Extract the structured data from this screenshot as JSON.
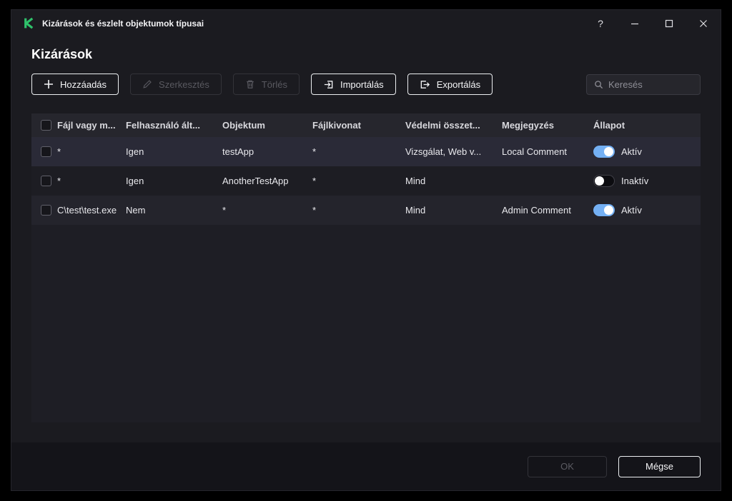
{
  "colors": {
    "brand_green": "#2fc26b",
    "toggle_active": "#74b0f4"
  },
  "window": {
    "title": "Kizárások és észlelt objektumok típusai",
    "controls": {
      "help": "?"
    }
  },
  "page": {
    "heading": "Kizárások"
  },
  "toolbar": {
    "add_label": "Hozzáadás",
    "edit_label": "Szerkesztés",
    "delete_label": "Törlés",
    "import_label": "Importálás",
    "export_label": "Exportálás",
    "search_placeholder": "Keresés"
  },
  "table": {
    "columns": {
      "path": "Fájl vagy m...",
      "user": "Felhasználó ált...",
      "object": "Objektum",
      "hash": "Fájlkivonat",
      "components": "Védelmi összet...",
      "comment": "Megjegyzés",
      "status": "Állapot"
    },
    "rows": [
      {
        "path": "*",
        "user": "Igen",
        "object": "testApp",
        "hash": "*",
        "components": "Vizsgálat, Web v...",
        "comment": "Local Comment",
        "status": "Aktív",
        "active": true
      },
      {
        "path": "*",
        "user": "Igen",
        "object": "AnotherTestApp",
        "hash": "*",
        "components": "Mind",
        "comment": "",
        "status": "Inaktív",
        "active": false
      },
      {
        "path": "C\\test\\test.exe",
        "user": "Nem",
        "object": "*",
        "hash": "*",
        "components": "Mind",
        "comment": "Admin Comment",
        "status": "Aktív",
        "active": true
      }
    ]
  },
  "footer": {
    "ok_label": "OK",
    "cancel_label": "Mégse"
  }
}
